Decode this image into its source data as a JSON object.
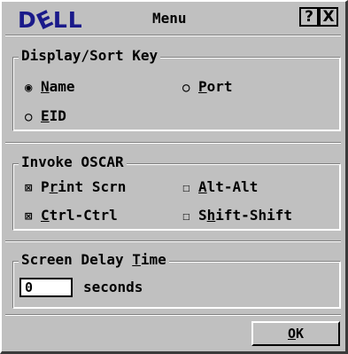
{
  "window": {
    "logo_pre": "D",
    "logo_tilt": "E",
    "logo_post": "LL",
    "title": "Menu",
    "help_label": "?",
    "close_label": "X"
  },
  "display_sort": {
    "legend_pre": "Display/Sort Key",
    "options": [
      {
        "glyph": "◉",
        "ul": "N",
        "rest": "ame",
        "selected": true
      },
      {
        "glyph": "○",
        "ul": "P",
        "rest": "ort",
        "selected": false
      },
      {
        "glyph": "○",
        "ul": "E",
        "rest": "ID",
        "selected": false
      }
    ]
  },
  "invoke_oscar": {
    "legend": "Invoke OSCAR",
    "options": [
      {
        "glyph": "⊠",
        "pre": "P",
        "ul": "r",
        "rest": "int Scrn",
        "checked": true
      },
      {
        "glyph": "☐",
        "pre": "",
        "ul": "A",
        "rest": "lt-Alt",
        "checked": false
      },
      {
        "glyph": "⊠",
        "pre": "",
        "ul": "C",
        "rest": "trl-Ctrl",
        "checked": true
      },
      {
        "glyph": "☐",
        "pre": "S",
        "ul": "h",
        "rest": "ift-Shift",
        "checked": false
      }
    ]
  },
  "screen_delay": {
    "legend_pre": "Screen Delay ",
    "legend_ul": "T",
    "legend_post": "ime",
    "value": "0",
    "unit": "seconds"
  },
  "ok": {
    "ul": "O",
    "rest": "K"
  }
}
